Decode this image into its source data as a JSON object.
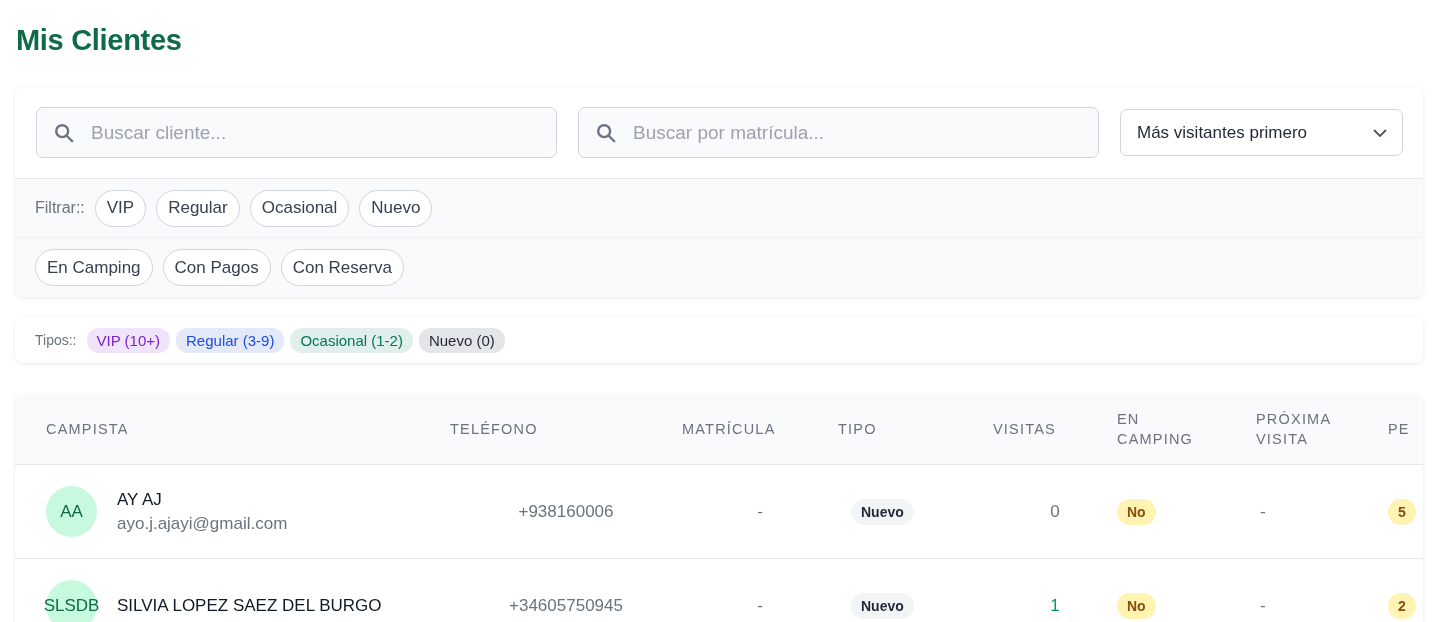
{
  "title": "Mis Clientes",
  "search": [
    {
      "placeholder": "Buscar cliente..."
    },
    {
      "placeholder": "Buscar por matrícula..."
    }
  ],
  "sort": {
    "value": "Más visitantes primero"
  },
  "filters": {
    "label": "Filtrar::",
    "rows": [
      [
        {
          "label": "VIP",
          "selected": false
        },
        {
          "label": "Regular",
          "selected": false
        },
        {
          "label": "Ocasional",
          "selected": false
        },
        {
          "label": "Nuevo",
          "selected": false
        }
      ],
      [
        {
          "label": "En Camping",
          "selected": false
        },
        {
          "label": "Con Pagos",
          "selected": false
        },
        {
          "label": "Con Reserva",
          "selected": false
        }
      ]
    ]
  },
  "legend": {
    "label": "Tipos::",
    "items": [
      {
        "label": "VIP (10+)",
        "color": "#7e22ce"
      },
      {
        "label": "Regular (3-9)",
        "color": "#1d4ed8"
      },
      {
        "label": "Ocasional (1-2)",
        "color": "#047857"
      },
      {
        "label": "Nuevo (0)",
        "color": "#1f2937"
      }
    ]
  },
  "table": {
    "columns": [
      [
        "CAMPISTA"
      ],
      [
        "TELÉFONO"
      ],
      [
        "MATRÍCULA"
      ],
      [
        "TIPO"
      ],
      [
        "VISITAS"
      ],
      [
        "EN",
        "CAMPING"
      ],
      [
        "PRÓXIMA",
        "VISITA"
      ],
      [
        "PE"
      ]
    ],
    "rows": [
      {
        "initials": "AA",
        "name": "AY AJ",
        "email": "ayo.j.ajayi@gmail.com",
        "phone": "+938160006",
        "plate": "-",
        "type": "Nuevo",
        "visits": "0",
        "visits_active": false,
        "in_camping": "No",
        "next_visit": "-",
        "column_8": "5"
      },
      {
        "initials": "SLSDB",
        "name": "SILVIA LOPEZ SAEZ DEL BURGO",
        "phone": "+34605750945",
        "plate": "-",
        "type": "Nuevo",
        "visits": "1",
        "visits_active": true,
        "in_camping": "No",
        "next_visit": "-",
        "column_8": "2"
      }
    ]
  }
}
